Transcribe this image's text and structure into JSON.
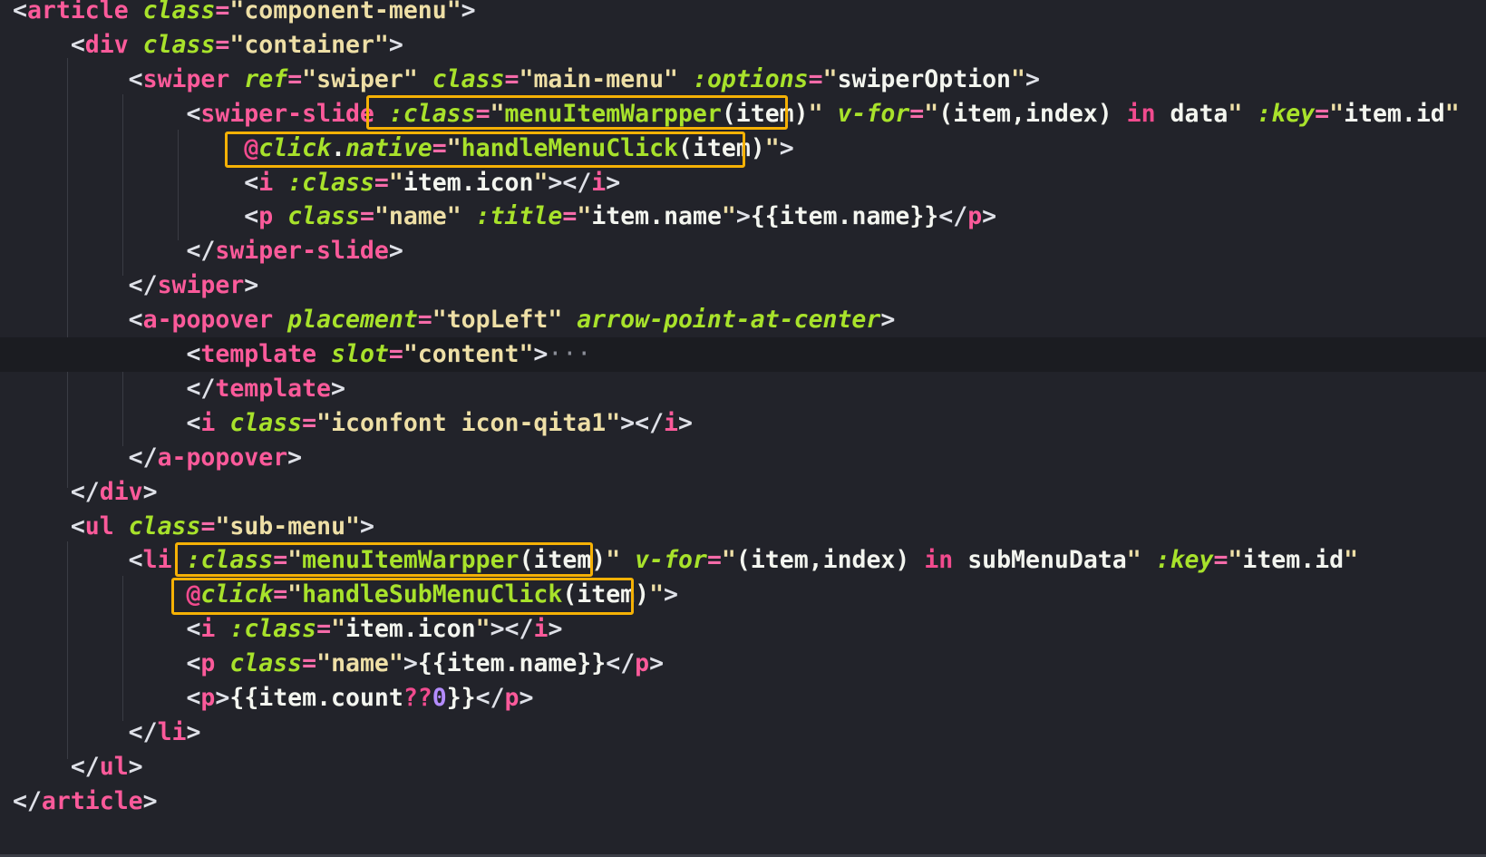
{
  "colors": {
    "background": "#22232a",
    "current_line": "#1b1c21",
    "highlight_box": "#f5b105",
    "tag": "#fb5a9a",
    "attribute": "#a8e22b",
    "string": "#eedfa6",
    "punctuation": "#dfe1e8"
  },
  "code_lines": [
    {
      "tokens": [
        {
          "k": "p",
          "t": "<"
        },
        {
          "k": "tag",
          "t": "article"
        },
        {
          "k": "s",
          "t": " "
        },
        {
          "k": "attr",
          "t": "class"
        },
        {
          "k": "eq",
          "t": "="
        },
        {
          "k": "str",
          "t": "\"component-menu\""
        },
        {
          "k": "p",
          "t": ">"
        }
      ]
    },
    {
      "tokens": [
        {
          "k": "s",
          "t": "    "
        },
        {
          "k": "p",
          "t": "<"
        },
        {
          "k": "tag",
          "t": "div"
        },
        {
          "k": "s",
          "t": " "
        },
        {
          "k": "attr",
          "t": "class"
        },
        {
          "k": "eq",
          "t": "="
        },
        {
          "k": "str",
          "t": "\"container\""
        },
        {
          "k": "p",
          "t": ">"
        }
      ]
    },
    {
      "tokens": [
        {
          "k": "s",
          "t": "        "
        },
        {
          "k": "p",
          "t": "<"
        },
        {
          "k": "tag",
          "t": "swiper"
        },
        {
          "k": "s",
          "t": " "
        },
        {
          "k": "attr",
          "t": "ref"
        },
        {
          "k": "eq",
          "t": "="
        },
        {
          "k": "str",
          "t": "\"swiper\""
        },
        {
          "k": "s",
          "t": " "
        },
        {
          "k": "attr",
          "t": "class"
        },
        {
          "k": "eq",
          "t": "="
        },
        {
          "k": "str",
          "t": "\"main-menu\""
        },
        {
          "k": "s",
          "t": " "
        },
        {
          "k": "attr",
          "t": ":options"
        },
        {
          "k": "eq",
          "t": "="
        },
        {
          "k": "str",
          "t": "\""
        },
        {
          "k": "g",
          "t": "swiperOption"
        },
        {
          "k": "str",
          "t": "\""
        },
        {
          "k": "p",
          "t": ">"
        }
      ]
    },
    {
      "tokens": [
        {
          "k": "s",
          "t": "            "
        },
        {
          "k": "p",
          "t": "<"
        },
        {
          "k": "tag",
          "t": "swiper-slide"
        },
        {
          "k": "s",
          "t": " "
        },
        {
          "k": "attr",
          "t": ":class"
        },
        {
          "k": "eq",
          "t": "="
        },
        {
          "k": "str",
          "t": "\""
        },
        {
          "k": "fn",
          "t": "menuItemWarpper"
        },
        {
          "k": "g",
          "t": "(item)"
        },
        {
          "k": "str",
          "t": "\""
        },
        {
          "k": "s",
          "t": " "
        },
        {
          "k": "attr",
          "t": "v-for"
        },
        {
          "k": "eq",
          "t": "="
        },
        {
          "k": "str",
          "t": "\""
        },
        {
          "k": "g",
          "t": "(item,index) "
        },
        {
          "k": "kw",
          "t": "in"
        },
        {
          "k": "g",
          "t": " data"
        },
        {
          "k": "str",
          "t": "\""
        },
        {
          "k": "s",
          "t": " "
        },
        {
          "k": "attr",
          "t": ":key"
        },
        {
          "k": "eq",
          "t": "="
        },
        {
          "k": "str",
          "t": "\""
        },
        {
          "k": "g",
          "t": "item.id"
        },
        {
          "k": "str",
          "t": "\""
        }
      ]
    },
    {
      "tokens": [
        {
          "k": "s",
          "t": "                "
        },
        {
          "k": "pink",
          "t": "@"
        },
        {
          "k": "attr",
          "t": "click"
        },
        {
          "k": "g",
          "t": "."
        },
        {
          "k": "attr",
          "t": "native"
        },
        {
          "k": "eq",
          "t": "="
        },
        {
          "k": "str",
          "t": "\""
        },
        {
          "k": "fn",
          "t": "handleMenuClick"
        },
        {
          "k": "g",
          "t": "(item)"
        },
        {
          "k": "str",
          "t": "\""
        },
        {
          "k": "p",
          "t": ">"
        }
      ]
    },
    {
      "tokens": [
        {
          "k": "s",
          "t": "                "
        },
        {
          "k": "p",
          "t": "<"
        },
        {
          "k": "tag",
          "t": "i"
        },
        {
          "k": "s",
          "t": " "
        },
        {
          "k": "attr",
          "t": ":class"
        },
        {
          "k": "eq",
          "t": "="
        },
        {
          "k": "str",
          "t": "\""
        },
        {
          "k": "g",
          "t": "item.icon"
        },
        {
          "k": "str",
          "t": "\""
        },
        {
          "k": "p",
          "t": "></"
        },
        {
          "k": "tag",
          "t": "i"
        },
        {
          "k": "p",
          "t": ">"
        }
      ]
    },
    {
      "tokens": [
        {
          "k": "s",
          "t": "                "
        },
        {
          "k": "p",
          "t": "<"
        },
        {
          "k": "tag",
          "t": "p"
        },
        {
          "k": "s",
          "t": " "
        },
        {
          "k": "attr",
          "t": "class"
        },
        {
          "k": "eq",
          "t": "="
        },
        {
          "k": "str",
          "t": "\"name\""
        },
        {
          "k": "s",
          "t": " "
        },
        {
          "k": "attr",
          "t": ":title"
        },
        {
          "k": "eq",
          "t": "="
        },
        {
          "k": "str",
          "t": "\""
        },
        {
          "k": "g",
          "t": "item.name"
        },
        {
          "k": "str",
          "t": "\""
        },
        {
          "k": "p",
          "t": ">"
        },
        {
          "k": "g",
          "t": "{{item.name}}"
        },
        {
          "k": "p",
          "t": "</"
        },
        {
          "k": "tag",
          "t": "p"
        },
        {
          "k": "p",
          "t": ">"
        }
      ]
    },
    {
      "tokens": [
        {
          "k": "s",
          "t": "            "
        },
        {
          "k": "p",
          "t": "</"
        },
        {
          "k": "tag",
          "t": "swiper-slide"
        },
        {
          "k": "p",
          "t": ">"
        }
      ]
    },
    {
      "tokens": [
        {
          "k": "s",
          "t": "        "
        },
        {
          "k": "p",
          "t": "</"
        },
        {
          "k": "tag",
          "t": "swiper"
        },
        {
          "k": "p",
          "t": ">"
        }
      ]
    },
    {
      "tokens": [
        {
          "k": "s",
          "t": "        "
        },
        {
          "k": "p",
          "t": "<"
        },
        {
          "k": "tag",
          "t": "a-popover"
        },
        {
          "k": "s",
          "t": " "
        },
        {
          "k": "attr",
          "t": "placement"
        },
        {
          "k": "eq",
          "t": "="
        },
        {
          "k": "str",
          "t": "\"topLeft\""
        },
        {
          "k": "s",
          "t": " "
        },
        {
          "k": "attr",
          "t": "arrow-point-at-center"
        },
        {
          "k": "p",
          "t": ">"
        }
      ]
    },
    {
      "current": true,
      "tokens": [
        {
          "k": "s",
          "t": "            "
        },
        {
          "k": "p",
          "t": "<"
        },
        {
          "k": "tag",
          "t": "template"
        },
        {
          "k": "s",
          "t": " "
        },
        {
          "k": "attr",
          "t": "slot"
        },
        {
          "k": "eq",
          "t": "="
        },
        {
          "k": "str",
          "t": "\"content\""
        },
        {
          "k": "p",
          "t": ">"
        },
        {
          "k": "dim",
          "t": "···"
        }
      ]
    },
    {
      "tokens": [
        {
          "k": "s",
          "t": "            "
        },
        {
          "k": "p",
          "t": "</"
        },
        {
          "k": "tag",
          "t": "template"
        },
        {
          "k": "p",
          "t": ">"
        }
      ]
    },
    {
      "tokens": [
        {
          "k": "s",
          "t": "            "
        },
        {
          "k": "p",
          "t": "<"
        },
        {
          "k": "tag",
          "t": "i"
        },
        {
          "k": "s",
          "t": " "
        },
        {
          "k": "attr",
          "t": "class"
        },
        {
          "k": "eq",
          "t": "="
        },
        {
          "k": "str",
          "t": "\"iconfont icon-qita1\""
        },
        {
          "k": "p",
          "t": "></"
        },
        {
          "k": "tag",
          "t": "i"
        },
        {
          "k": "p",
          "t": ">"
        }
      ]
    },
    {
      "tokens": [
        {
          "k": "s",
          "t": "        "
        },
        {
          "k": "p",
          "t": "</"
        },
        {
          "k": "tag",
          "t": "a-popover"
        },
        {
          "k": "p",
          "t": ">"
        }
      ]
    },
    {
      "tokens": [
        {
          "k": "s",
          "t": "    "
        },
        {
          "k": "p",
          "t": "</"
        },
        {
          "k": "tag",
          "t": "div"
        },
        {
          "k": "p",
          "t": ">"
        }
      ]
    },
    {
      "tokens": [
        {
          "k": "s",
          "t": "    "
        },
        {
          "k": "p",
          "t": "<"
        },
        {
          "k": "tag",
          "t": "ul"
        },
        {
          "k": "s",
          "t": " "
        },
        {
          "k": "attr",
          "t": "class"
        },
        {
          "k": "eq",
          "t": "="
        },
        {
          "k": "str",
          "t": "\"sub-menu\""
        },
        {
          "k": "p",
          "t": ">"
        }
      ]
    },
    {
      "tokens": [
        {
          "k": "s",
          "t": "        "
        },
        {
          "k": "p",
          "t": "<"
        },
        {
          "k": "tag",
          "t": "li"
        },
        {
          "k": "s",
          "t": " "
        },
        {
          "k": "attr",
          "t": ":class"
        },
        {
          "k": "eq",
          "t": "="
        },
        {
          "k": "str",
          "t": "\""
        },
        {
          "k": "fn",
          "t": "menuItemWarpper"
        },
        {
          "k": "g",
          "t": "(item)"
        },
        {
          "k": "str",
          "t": "\""
        },
        {
          "k": "s",
          "t": " "
        },
        {
          "k": "attr",
          "t": "v-for"
        },
        {
          "k": "eq",
          "t": "="
        },
        {
          "k": "str",
          "t": "\""
        },
        {
          "k": "g",
          "t": "(item,index) "
        },
        {
          "k": "kw",
          "t": "in"
        },
        {
          "k": "g",
          "t": " subMenuData"
        },
        {
          "k": "str",
          "t": "\""
        },
        {
          "k": "s",
          "t": " "
        },
        {
          "k": "attr",
          "t": ":key"
        },
        {
          "k": "eq",
          "t": "="
        },
        {
          "k": "str",
          "t": "\""
        },
        {
          "k": "g",
          "t": "item.id"
        },
        {
          "k": "str",
          "t": "\""
        }
      ]
    },
    {
      "tokens": [
        {
          "k": "s",
          "t": "            "
        },
        {
          "k": "pink",
          "t": "@"
        },
        {
          "k": "attr",
          "t": "click"
        },
        {
          "k": "eq",
          "t": "="
        },
        {
          "k": "str",
          "t": "\""
        },
        {
          "k": "fn",
          "t": "handleSubMenuClick"
        },
        {
          "k": "g",
          "t": "(item)"
        },
        {
          "k": "str",
          "t": "\""
        },
        {
          "k": "p",
          "t": ">"
        }
      ]
    },
    {
      "tokens": [
        {
          "k": "s",
          "t": "            "
        },
        {
          "k": "p",
          "t": "<"
        },
        {
          "k": "tag",
          "t": "i"
        },
        {
          "k": "s",
          "t": " "
        },
        {
          "k": "attr",
          "t": ":class"
        },
        {
          "k": "eq",
          "t": "="
        },
        {
          "k": "str",
          "t": "\""
        },
        {
          "k": "g",
          "t": "item.icon"
        },
        {
          "k": "str",
          "t": "\""
        },
        {
          "k": "p",
          "t": "></"
        },
        {
          "k": "tag",
          "t": "i"
        },
        {
          "k": "p",
          "t": ">"
        }
      ]
    },
    {
      "tokens": [
        {
          "k": "s",
          "t": "            "
        },
        {
          "k": "p",
          "t": "<"
        },
        {
          "k": "tag",
          "t": "p"
        },
        {
          "k": "s",
          "t": " "
        },
        {
          "k": "attr",
          "t": "class"
        },
        {
          "k": "eq",
          "t": "="
        },
        {
          "k": "str",
          "t": "\"name\""
        },
        {
          "k": "p",
          "t": ">"
        },
        {
          "k": "g",
          "t": "{{item.name}}"
        },
        {
          "k": "p",
          "t": "</"
        },
        {
          "k": "tag",
          "t": "p"
        },
        {
          "k": "p",
          "t": ">"
        }
      ]
    },
    {
      "tokens": [
        {
          "k": "s",
          "t": "            "
        },
        {
          "k": "p",
          "t": "<"
        },
        {
          "k": "tag",
          "t": "p"
        },
        {
          "k": "p",
          "t": ">"
        },
        {
          "k": "g",
          "t": "{{item.count"
        },
        {
          "k": "pink",
          "t": "??"
        },
        {
          "k": "num",
          "t": "0"
        },
        {
          "k": "g",
          "t": "}}"
        },
        {
          "k": "p",
          "t": "</"
        },
        {
          "k": "tag",
          "t": "p"
        },
        {
          "k": "p",
          "t": ">"
        }
      ]
    },
    {
      "tokens": [
        {
          "k": "s",
          "t": "        "
        },
        {
          "k": "p",
          "t": "</"
        },
        {
          "k": "tag",
          "t": "li"
        },
        {
          "k": "p",
          "t": ">"
        }
      ]
    },
    {
      "tokens": [
        {
          "k": "s",
          "t": "    "
        },
        {
          "k": "p",
          "t": "</"
        },
        {
          "k": "tag",
          "t": "ul"
        },
        {
          "k": "p",
          "t": ">"
        }
      ]
    },
    {
      "tokens": [
        {
          "k": "p",
          "t": "</"
        },
        {
          "k": "tag",
          "t": "article"
        },
        {
          "k": "p",
          "t": ">"
        }
      ]
    }
  ]
}
